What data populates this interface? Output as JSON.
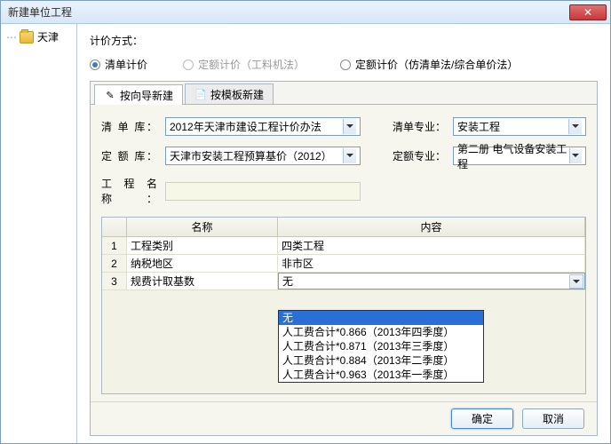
{
  "window": {
    "title": "新建单位工程"
  },
  "sidebar": {
    "node": "天津"
  },
  "pricing": {
    "label": "计价方式：",
    "options": [
      "清单计价",
      "定额计价（工料机法）",
      "定额计价（仿清单法/综合单价法）"
    ],
    "selected": 0
  },
  "tabs": {
    "wizard": "按向导新建",
    "template": "按模板新建"
  },
  "form": {
    "lib_label": "清 单 库：",
    "lib_value": "2012年天津市建设工程计价办法",
    "list_spec_label": "清单专业：",
    "list_spec_value": "安装工程",
    "quota_label": "定 额 库：",
    "quota_value": "天津市安装工程预算基价（2012）",
    "quota_spec_label": "定额专业：",
    "quota_spec_value": "第二册 电气设备安装工程",
    "name_label": "工程名称："
  },
  "grid": {
    "head_name": "名称",
    "head_content": "内容",
    "rows": [
      {
        "num": "1",
        "name": "工程类别",
        "content": "四类工程"
      },
      {
        "num": "2",
        "name": "纳税地区",
        "content": "非市区"
      },
      {
        "num": "3",
        "name": "规费计取基数",
        "content": "无"
      }
    ],
    "dropdown": [
      "无",
      "人工费合计*0.866（2013年四季度）",
      "人工费合计*0.871（2013年三季度）",
      "人工费合计*0.884（2013年二季度）",
      "人工费合计*0.963（2013年一季度）"
    ]
  },
  "buttons": {
    "ok": "确定",
    "cancel": "取消"
  }
}
